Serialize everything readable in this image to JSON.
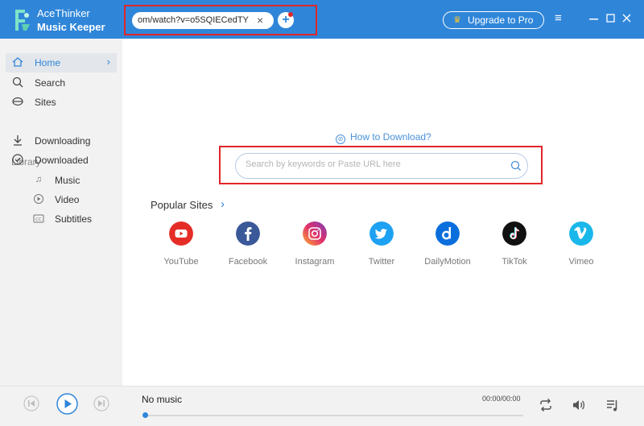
{
  "app": {
    "name_line1": "AceThinker",
    "name_line2": "Music Keeper"
  },
  "tab": {
    "url_text": "om/watch?v=o5SQIECedTY",
    "close": "×",
    "add": "+"
  },
  "header": {
    "upgrade_label": "Upgrade to Pro"
  },
  "sidebar": {
    "home": "Home",
    "search": "Search",
    "sites": "Sites",
    "library_heading": "Library",
    "downloading": "Downloading",
    "downloaded": "Downloaded",
    "music": "Music",
    "video": "Video",
    "subtitles": "Subtitles"
  },
  "main": {
    "how_to": "How to Download?",
    "search_placeholder": "Search by keywords or Paste URL here",
    "popular_sites_heading": "Popular Sites",
    "sites": [
      {
        "name": "YouTube",
        "color": "#e52d27"
      },
      {
        "name": "Facebook",
        "color": "#3b5998"
      },
      {
        "name": "Instagram",
        "color": "#d6249f"
      },
      {
        "name": "Twitter",
        "color": "#1da1f2"
      },
      {
        "name": "DailyMotion",
        "color": "#0a6fdc"
      },
      {
        "name": "TikTok",
        "color": "#111111"
      },
      {
        "name": "Vimeo",
        "color": "#1ab7ea"
      }
    ]
  },
  "player": {
    "now_playing": "No music",
    "time": "00:00/00:00",
    "progress": 0
  },
  "colors": {
    "accent": "#2f86d9",
    "highlight_box": "#e0262a"
  }
}
